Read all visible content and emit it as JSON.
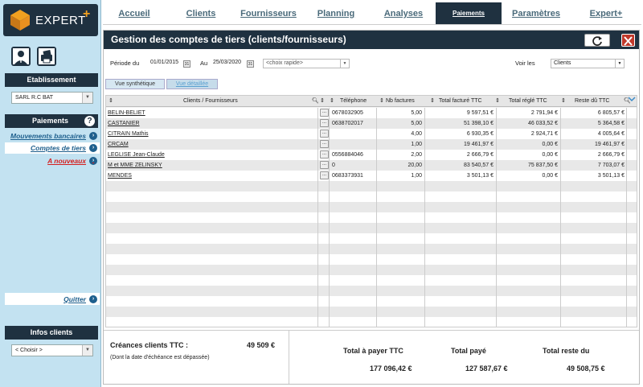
{
  "app": {
    "logo_text": "EXPERT",
    "logo_plus": "+"
  },
  "nav": {
    "tabs": [
      {
        "label": "Accueil"
      },
      {
        "label": "Clients"
      },
      {
        "label": "Fournisseurs"
      },
      {
        "label": "Planning"
      },
      {
        "label": "Analyses"
      },
      {
        "label": "Paiements",
        "active": true
      },
      {
        "label": "Paramètres"
      },
      {
        "label": "Expert+"
      }
    ]
  },
  "sidebar": {
    "establishment_header": "Etablissement",
    "establishment_value": "SARL R.C BAT",
    "payments_header": "Paiements",
    "help_glyph": "?",
    "links": [
      {
        "label": "Mouvements bancaires"
      },
      {
        "label": "Comptes de tiers",
        "active": true
      },
      {
        "label": "A nouveaux"
      }
    ],
    "quit_label": "Quitter",
    "infos_header": "Infos clients",
    "infos_select": "< Choisir >"
  },
  "panel": {
    "title": "Gestion des comptes de tiers (clients/fournisseurs)",
    "period_label": "Période du",
    "date_from": "01/01/2015",
    "date_to_label": "Au",
    "date_to": "25/03/2020",
    "calendar_glyph": "31",
    "quick_choice": "<choix rapide>",
    "view_label": "Voir les",
    "view_value": "Clients",
    "view_tabs": [
      {
        "label": "Vue synthétique",
        "active": true
      },
      {
        "label": "Vue détaillée"
      }
    ]
  },
  "grid": {
    "columns": [
      "Clients / Fournisseurs",
      "Téléphone",
      "Nb factures",
      "Total facturé TTC",
      "Total réglé TTC",
      "Reste dû TTC"
    ],
    "rows": [
      {
        "name": "BELIN-BELIET",
        "phone": "0678032905",
        "count": "5,00",
        "invoiced": "9 597,51 €",
        "paid": "2 791,94 €",
        "due": "6 805,57 €"
      },
      {
        "name": "CASTANIER",
        "phone": "0638702017",
        "count": "5,00",
        "invoiced": "51 398,10 €",
        "paid": "46 033,52 €",
        "due": "5 364,58 €"
      },
      {
        "name": "CITRAIN Mathis",
        "phone": "",
        "count": "4,00",
        "invoiced": "6 930,35 €",
        "paid": "2 924,71 €",
        "due": "4 005,64 €"
      },
      {
        "name": "CRCAM",
        "phone": "",
        "count": "1,00",
        "invoiced": "19 461,97 €",
        "paid": "0,00 €",
        "due": "19 461,97 €"
      },
      {
        "name": "LEGLISE Jean-Claude",
        "phone": "0556884046",
        "count": "2,00",
        "invoiced": "2 666,79 €",
        "paid": "0,00 €",
        "due": "2 666,79 €"
      },
      {
        "name": "M et MME ZELINSKY",
        "phone": "0",
        "count": "20,00",
        "invoiced": "83 540,57 €",
        "paid": "75 837,50 €",
        "due": "7 703,07 €"
      },
      {
        "name": "MENDES",
        "phone": "0683373931",
        "count": "1,00",
        "invoiced": "3 501,13 €",
        "paid": "0,00 €",
        "due": "3 501,13 €"
      }
    ],
    "dots_glyph": "..."
  },
  "footer": {
    "receivables_label": "Créances clients TTC :",
    "receivables_value": "49 509 €",
    "receivables_note": "(Dont la date d'échéance est dépassée)",
    "total_to_pay_label": "Total à payer TTC",
    "total_to_pay_value": "177 096,42 €",
    "total_paid_label": "Total payé",
    "total_paid_value": "127 587,67 €",
    "total_remaining_label": "Total reste du",
    "total_remaining_value": "49 508,75 €"
  },
  "colors": {
    "dark": "#1f3140",
    "accent": "#f0a020",
    "link_blue": "#1e5f8d",
    "link_red": "#d42020"
  }
}
